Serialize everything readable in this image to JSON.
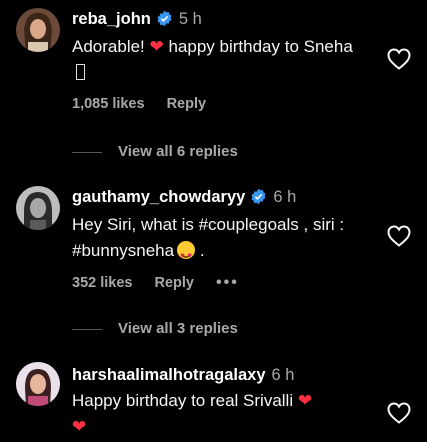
{
  "comments": [
    {
      "username": "reba_john",
      "time": "5 h",
      "text_before": "Adorable! ",
      "heart_emoji": "❤",
      "text_after": " happy birthday to Sneha ",
      "likes": "1,085 likes",
      "reply_label": "Reply",
      "view_replies": "View all 6 replies"
    },
    {
      "username": "gauthamy_chowdaryy",
      "time": "6 h",
      "text_before": "Hey Siri, what is #couplegoals , siri : #bunnysneha",
      "text_after": " .",
      "likes": "352 likes",
      "reply_label": "Reply",
      "more": "•••",
      "view_replies": "View all 3 replies"
    },
    {
      "username": "harshaalimalhotragalaxy",
      "time": "6 h",
      "text_before": "Happy birthday to real Srivalli ",
      "heart_emoji": "❤",
      "heart_emoji_2": "❤"
    }
  ]
}
